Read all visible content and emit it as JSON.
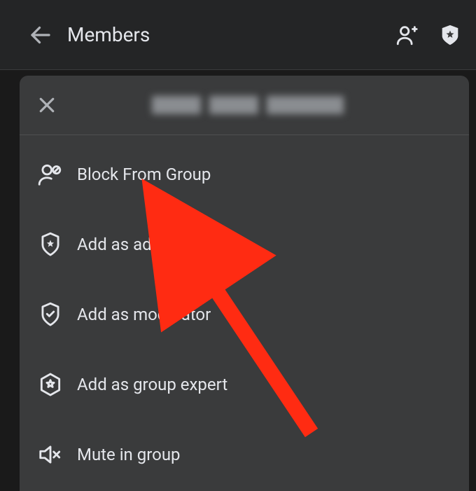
{
  "header": {
    "title": "Members"
  },
  "sheet": {
    "member_name": "[redacted]"
  },
  "menu": {
    "items": [
      {
        "id": "block",
        "label": "Block From Group",
        "icon": "person-blocked-icon"
      },
      {
        "id": "admin",
        "label": "Add as admin",
        "icon": "shield-star-icon"
      },
      {
        "id": "moderator",
        "label": "Add as moderator",
        "icon": "shield-check-icon"
      },
      {
        "id": "expert",
        "label": "Add as group expert",
        "icon": "hexagon-star-icon"
      },
      {
        "id": "mute",
        "label": "Mute in group",
        "icon": "speaker-mute-icon"
      }
    ]
  },
  "annotation": {
    "arrow_target": "admin",
    "arrow_color": "#ff2b12"
  }
}
